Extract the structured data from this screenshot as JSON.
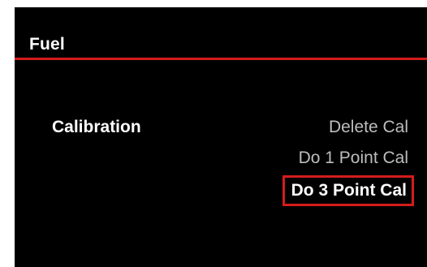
{
  "header": {
    "title": "Fuel"
  },
  "setting": {
    "label": "Calibration"
  },
  "options": [
    {
      "label": "Delete Cal",
      "selected": false
    },
    {
      "label": "Do 1 Point Cal",
      "selected": false
    },
    {
      "label": "Do 3 Point Cal",
      "selected": true
    }
  ],
  "colors": {
    "background": "#000000",
    "accent": "#d41c1c",
    "text_primary": "#ffffff",
    "text_secondary": "#bdbdbd"
  }
}
